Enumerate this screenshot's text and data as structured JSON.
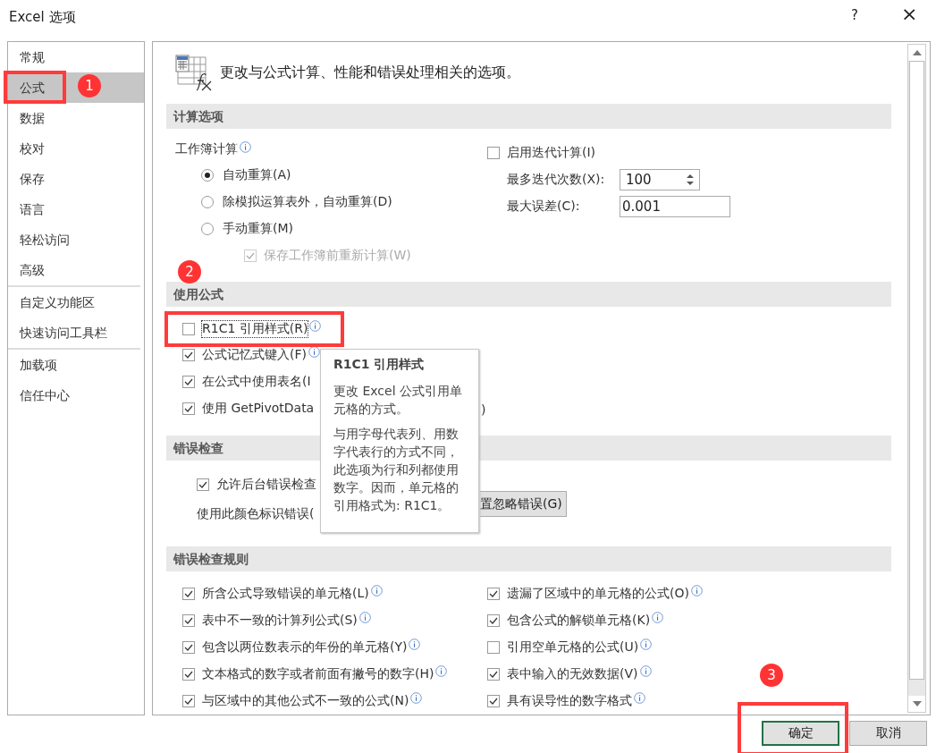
{
  "window": {
    "title": "Excel 选项",
    "help": "?",
    "close": "×"
  },
  "sidebar": {
    "groups": [
      [
        {
          "label": "常规",
          "selected": false
        },
        {
          "label": "公式",
          "selected": true
        },
        {
          "label": "数据",
          "selected": false
        },
        {
          "label": "校对",
          "selected": false
        },
        {
          "label": "保存",
          "selected": false
        },
        {
          "label": "语言",
          "selected": false
        },
        {
          "label": "轻松访问",
          "selected": false
        },
        {
          "label": "高级",
          "selected": false
        }
      ],
      [
        {
          "label": "自定义功能区",
          "selected": false
        },
        {
          "label": "快速访问工具栏",
          "selected": false
        }
      ],
      [
        {
          "label": "加载项",
          "selected": false
        },
        {
          "label": "信任中心",
          "selected": false
        }
      ]
    ]
  },
  "header": {
    "text": "更改与公式计算、性能和错误处理相关的选项。"
  },
  "calculation": {
    "title": "计算选项",
    "workbook_label": "工作簿计算",
    "modes": [
      {
        "label": "自动重算(A)",
        "selected": true
      },
      {
        "label": "除模拟运算表外，自动重算(D)",
        "selected": false
      },
      {
        "label": "手动重算(M)",
        "selected": false
      }
    ],
    "save_before": {
      "label": "保存工作簿前重新计算(W)",
      "checked": true,
      "disabled": true
    },
    "iterative": {
      "label": "启用迭代计算(I)",
      "checked": false
    },
    "max_iterations": {
      "label": "最多迭代次数(X):",
      "value": "100"
    },
    "max_change": {
      "label": "最大误差(C):",
      "value": "0.001"
    }
  },
  "formulas": {
    "title": "使用公式",
    "options": [
      {
        "label": "R1C1 引用样式(R)",
        "checked": false,
        "info": true,
        "focused": true
      },
      {
        "label": "公式记忆式键入(F)",
        "checked": true,
        "info": true
      },
      {
        "label": "在公式中使用表名(I",
        "checked": true
      },
      {
        "label": "使用 GetPivotData",
        "checked": true,
        "tail": ")"
      }
    ]
  },
  "error_checking": {
    "title": "错误检查",
    "background": {
      "label": "允许后台错误检查",
      "checked": true
    },
    "color_label": "使用此颜色标识错误(",
    "reset_button": "置忽略错误(G)"
  },
  "rules": {
    "title": "错误检查规则",
    "left": [
      {
        "label": "所含公式导致错误的单元格(L)",
        "checked": true
      },
      {
        "label": "表中不一致的计算列公式(S)",
        "checked": true
      },
      {
        "label": "包含以两位数表示的年份的单元格(Y)",
        "checked": true
      },
      {
        "label": "文本格式的数字或者前面有撇号的数字(H)",
        "checked": true
      },
      {
        "label": "与区域中的其他公式不一致的公式(N)",
        "checked": true
      }
    ],
    "right": [
      {
        "label": "遗漏了区域中的单元格的公式(O)",
        "checked": true
      },
      {
        "label": "包含公式的解锁单元格(K)",
        "checked": true
      },
      {
        "label": "引用空单元格的公式(U)",
        "checked": false
      },
      {
        "label": "表中输入的无效数据(V)",
        "checked": true
      },
      {
        "label": "具有误导性的数字格式",
        "checked": true
      }
    ]
  },
  "tooltip": {
    "title": "R1C1 引用样式",
    "paragraphs": [
      "更改 Excel 公式引用单元格的方式。",
      "与用字母代表列、用数字代表行的方式不同，此选项为行和列都使用数字。因而，单元格的引用格式为: R1C1。"
    ]
  },
  "buttons": [
    {
      "label": "确定",
      "default": true
    },
    {
      "label": "取消",
      "default": false
    }
  ],
  "annotations": [
    {
      "number": "1"
    },
    {
      "number": "2"
    },
    {
      "number": "3"
    }
  ]
}
